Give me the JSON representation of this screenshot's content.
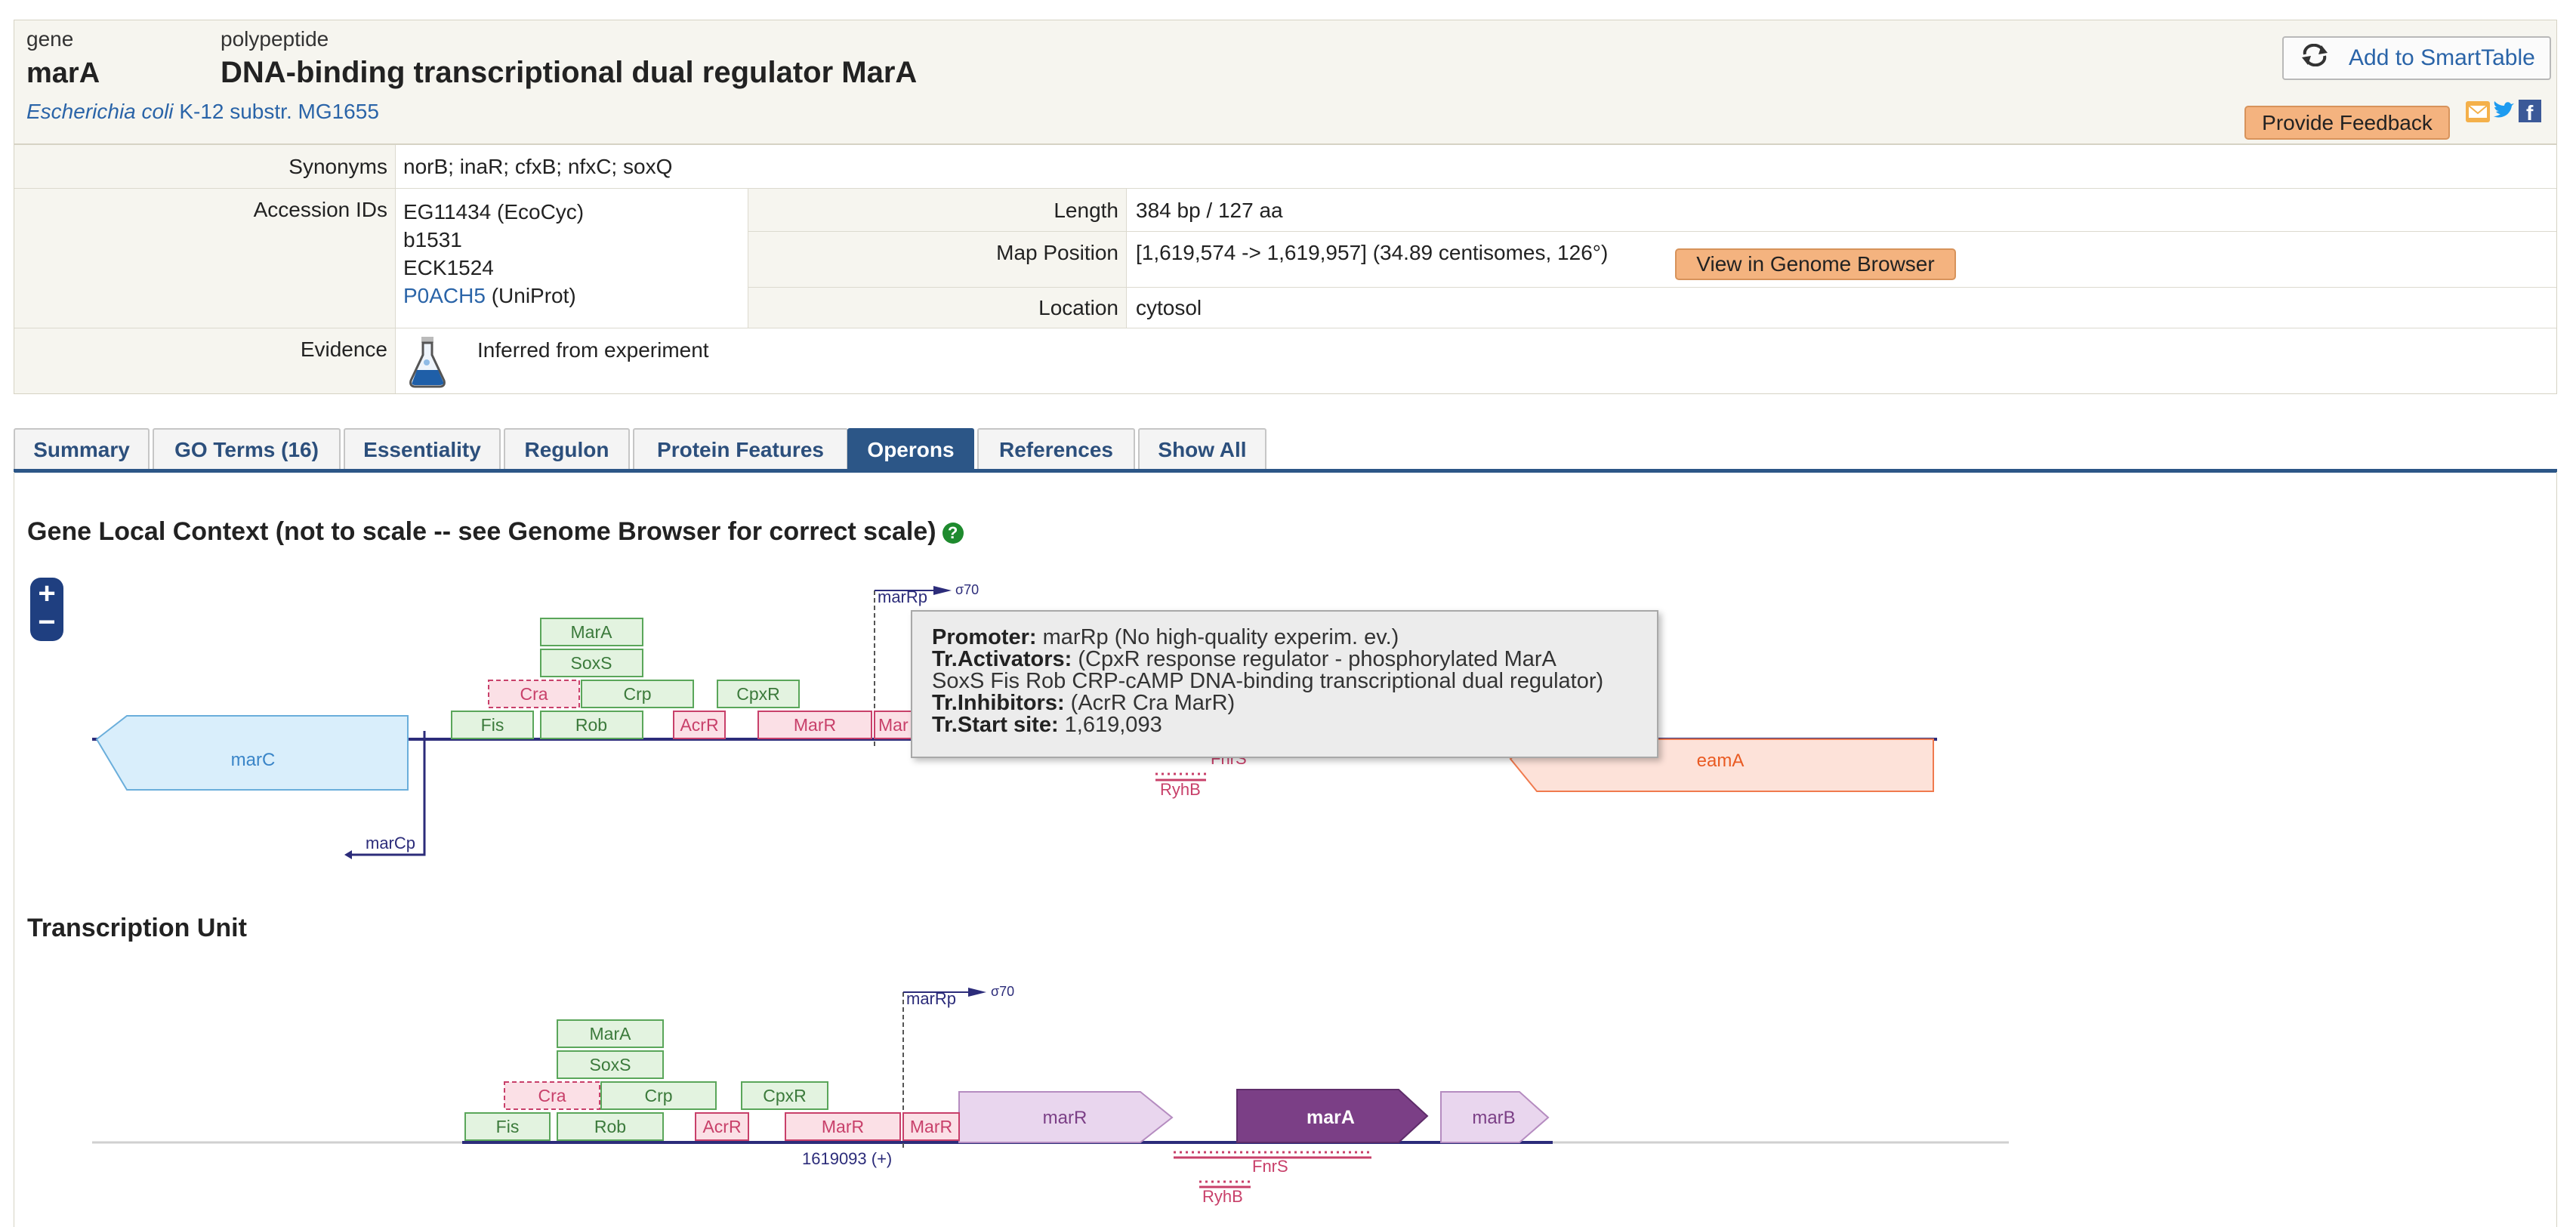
{
  "header": {
    "type_label": "gene",
    "gene_name": "marA",
    "poly_label": "polypeptide",
    "poly_name": "DNA-binding transcriptional dual regulator MarA",
    "organism_species": "Escherichia coli",
    "organism_strain": "K-12 substr. MG1655",
    "smarttable_label": "Add to SmartTable",
    "feedback_label": "Provide Feedback"
  },
  "properties": {
    "synonyms_label": "Synonyms",
    "synonyms_value": "norB; inaR; cfxB; nfxC; soxQ",
    "accession_label": "Accession IDs",
    "accession": [
      "EG11434 (EcoCyc)",
      "b1531",
      "ECK1524"
    ],
    "accession_link": "P0ACH5",
    "accession_link_suffix": " (UniProt)",
    "length_label": "Length",
    "length_value": "384 bp / 127 aa",
    "mappos_label": "Map Position",
    "mappos_value": "[1,619,574 -> 1,619,957] (34.89 centisomes, 126°)",
    "genome_browser_label": "View in Genome Browser",
    "location_label": "Location",
    "location_value": "cytosol",
    "evidence_label": "Evidence",
    "evidence_value": "Inferred from experiment"
  },
  "tabs": [
    {
      "label": "Summary",
      "active": false
    },
    {
      "label": "GO Terms (16)",
      "active": false
    },
    {
      "label": "Essentiality",
      "active": false
    },
    {
      "label": "Regulon",
      "active": false
    },
    {
      "label": "Protein Features",
      "active": false
    },
    {
      "label": "Operons",
      "active": true
    },
    {
      "label": "References",
      "active": false
    },
    {
      "label": "Show All",
      "active": false
    }
  ],
  "context": {
    "title": "Gene Local Context (not to scale -- see Genome Browser for correct scale)",
    "zoom_in": "+",
    "zoom_out": "−",
    "promoter_label": "marRp",
    "sigma": "σ70",
    "promoter2_label": "marCp",
    "gene_marC": "marC",
    "gene_eamA": "eamA",
    "fnrs": "FnrS",
    "ryhb": "RyhB",
    "sites": {
      "mara": "MarA",
      "soxs": "SoxS",
      "cra": "Cra",
      "crp": "Crp",
      "cpxr": "CpxR",
      "fis": "Fis",
      "rob": "Rob",
      "acrr": "AcrR",
      "marr": "MarR",
      "marr_short": "Mar"
    }
  },
  "tooltip": {
    "promoter_key": "Promoter:",
    "promoter_val": " marRp (No high-quality experim. ev.)",
    "act_key": "Tr.Activators:",
    "act_val": " (CpxR response regulator - phosphorylated MarA",
    "act_val2": "SoxS Fis Rob CRP-cAMP DNA-binding transcriptional dual regulator)",
    "inh_key": "Tr.Inhibitors:",
    "inh_val": " (AcrR Cra MarR)",
    "start_key": "Tr.Start site:",
    "start_val": " 1,619,093"
  },
  "tu": {
    "title": "Transcription Unit",
    "promoter_label": "marRp",
    "sigma": "σ70",
    "position": "1619093 (+)",
    "gene_marR": "marR",
    "gene_marA": "marA",
    "gene_marB": "marB",
    "fnrs": "FnrS",
    "ryhb": "RyhB",
    "sites": {
      "mara": "MarA",
      "soxs": "SoxS",
      "cra": "Cra",
      "crp": "Crp",
      "cpxr": "CpxR",
      "fis": "Fis",
      "rob": "Rob",
      "acrr": "AcrR",
      "marr": "MarR",
      "marr2": "MarR"
    }
  },
  "colors": {
    "accent": "#2c5687",
    "link": "#2a64a8",
    "activator_fill": "#e3f3e0",
    "activator_stroke": "#5aa65a",
    "inhibitor_fill": "#fbe0e6",
    "inhibitor_stroke": "#c8406a",
    "operon_gene": "#e9d6ee",
    "operon_target": "#7b3f86"
  }
}
